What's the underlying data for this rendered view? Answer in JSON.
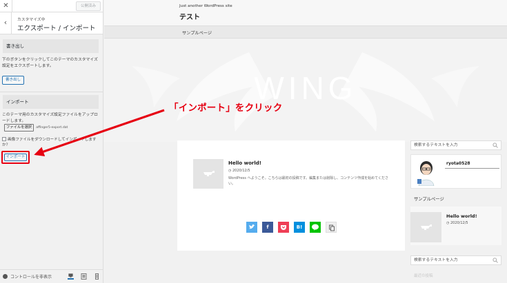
{
  "customizer": {
    "publish_label": "公開済み",
    "section_subtitle": "カスタマイズ中",
    "section_title": "エクスポート / インポート",
    "export": {
      "heading": "書き出し",
      "description": "下のボタンをクリックしてこのテーマのカスタマイズ設定をエクスポートします。",
      "button_label": "書き出し"
    },
    "import": {
      "heading": "インポート",
      "description": "このテーマ用のカスタマイズ設定ファイルをアップロードします。",
      "file_button_label": "ファイルを選択",
      "file_name": "affinger5-export.dat",
      "checkbox_label": "画像ファイルをダウンロードしてインポートしますか？",
      "button_label": "インポート"
    },
    "footer": {
      "hide_controls_label": "コントロールを非表示"
    }
  },
  "preview": {
    "tagline": "Just another WordPress site",
    "site_title": "テスト",
    "nav_items": [
      "サンプルページ"
    ],
    "hero_text": "WING",
    "post": {
      "title": "Hello world!",
      "date": "2020/12/5",
      "excerpt": "WordPress へようこそ。こちらは最初の投稿です。編集または削除し、コンテンツ作成を始めてください。"
    },
    "share_buttons": [
      {
        "icon": "twitter-icon",
        "label": "",
        "color": "#55acee"
      },
      {
        "icon": "facebook-icon",
        "label": "f",
        "color": "#3b5998"
      },
      {
        "icon": "pocket-icon",
        "label": "",
        "color": "#ef3f56"
      },
      {
        "icon": "hatena-icon",
        "label": "B!",
        "color": "#008fde"
      },
      {
        "icon": "line-icon",
        "label": "",
        "color": "#00c300"
      },
      {
        "icon": "copy-icon",
        "label": "",
        "color": "#eeeeee"
      }
    ],
    "sidebar": {
      "search_placeholder_1": "検索するテキストを入力",
      "profile_name": "ryota0528",
      "sample_page_label": "サンプルページ",
      "post_title": "Hello world!",
      "post_date": "2020/12/5",
      "search_placeholder_2": "検索するテキストを入力",
      "faded_heading": "最近の投稿"
    }
  },
  "annotation": {
    "text": "「インポート」をクリック",
    "color": "#e60012"
  }
}
